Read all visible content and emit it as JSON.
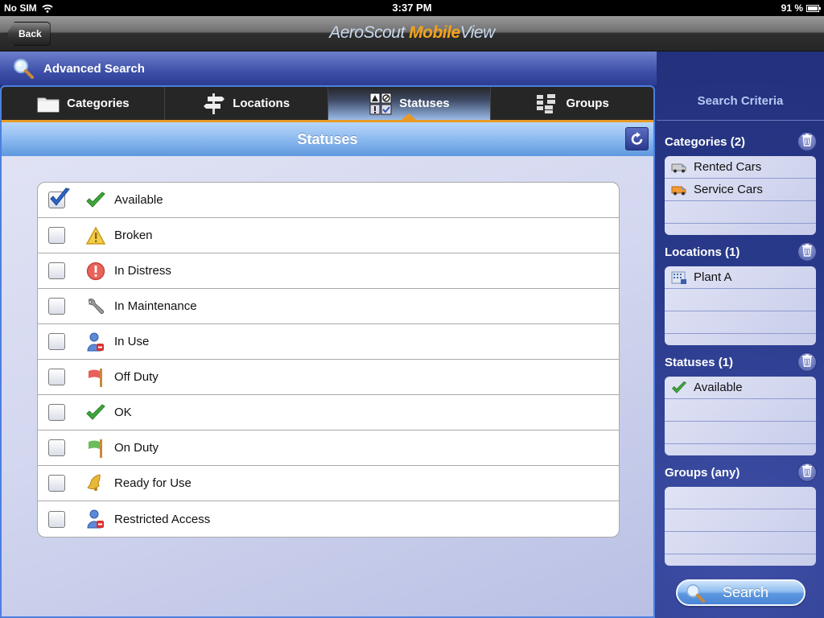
{
  "status_bar": {
    "carrier": "No SIM",
    "time": "3:37 PM",
    "battery": "91 %"
  },
  "nav": {
    "back_label": "Back",
    "brand_part1": "AeroScout ",
    "brand_part2": "Mobile",
    "brand_part3": "View"
  },
  "header": {
    "title": "Advanced Search",
    "icon": "magnifier-icon"
  },
  "tabs": [
    {
      "label": "Categories",
      "icon": "folder-icon",
      "active": false
    },
    {
      "label": "Locations",
      "icon": "signpost-icon",
      "active": false
    },
    {
      "label": "Statuses",
      "icon": "status-grid-icon",
      "active": true
    },
    {
      "label": "Groups",
      "icon": "groups-icon",
      "active": false
    }
  ],
  "section": {
    "title": "Statuses",
    "refresh_icon": "refresh-icon"
  },
  "statuses": [
    {
      "label": "Available",
      "icon": "green-check-icon",
      "checked": true
    },
    {
      "label": "Broken",
      "icon": "warning-triangle-icon",
      "checked": false
    },
    {
      "label": "In Distress",
      "icon": "red-exclamation-icon",
      "checked": false
    },
    {
      "label": "In Maintenance",
      "icon": "wrench-icon",
      "checked": false
    },
    {
      "label": "In Use",
      "icon": "user-blocked-icon",
      "checked": false
    },
    {
      "label": "Off Duty",
      "icon": "red-flag-icon",
      "checked": false
    },
    {
      "label": "OK",
      "icon": "green-check-icon",
      "checked": false
    },
    {
      "label": "On Duty",
      "icon": "green-flag-icon",
      "checked": false
    },
    {
      "label": "Ready for Use",
      "icon": "bell-icon",
      "checked": false
    },
    {
      "label": "Restricted Access",
      "icon": "user-blocked-icon",
      "checked": false
    }
  ],
  "criteria": {
    "title": "Search Criteria",
    "categories": {
      "label": "Categories (2)",
      "items": [
        {
          "label": "Rented Cars",
          "icon": "gray-van-icon"
        },
        {
          "label": "Service Cars",
          "icon": "orange-van-icon"
        }
      ]
    },
    "locations": {
      "label": "Locations (1)",
      "items": [
        {
          "label": "Plant A",
          "icon": "building-icon"
        }
      ]
    },
    "statuses": {
      "label": "Statuses (1)",
      "items": [
        {
          "label": "Available",
          "icon": "green-check-icon"
        }
      ]
    },
    "groups": {
      "label": "Groups (any)",
      "items": []
    },
    "search_label": "Search"
  },
  "colors": {
    "accent_orange": "#e89a24",
    "panel_blue": "#22307a",
    "tab_bar": "#262626",
    "section_blue": "#5f98de"
  }
}
